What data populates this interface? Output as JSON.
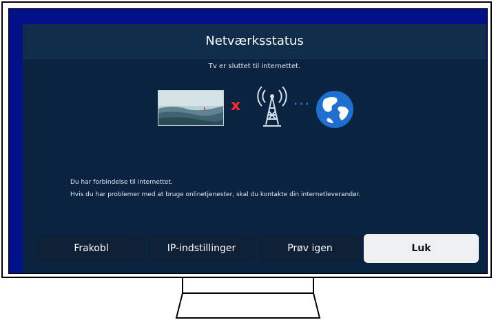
{
  "dialog": {
    "title": "Netværksstatus",
    "status_line": "Tv er sluttet til internettet.",
    "message_lines": [
      "Du har forbindelse til internettet.",
      "Hvis du har problemer med at bruge onlinetjenester, skal du kontakte din internetleverandør."
    ],
    "diagram": {
      "icons": [
        "tv-thumbnail-icon",
        "x-mark-icon",
        "antenna-tower-icon",
        "dotted-connection-icon",
        "globe-icon"
      ],
      "x_mark": "x",
      "dots": "···"
    },
    "buttons": [
      {
        "label": "Frakobl"
      },
      {
        "label": "IP-indstillinger"
      },
      {
        "label": "Prøv igen"
      },
      {
        "label": "Luk",
        "selected": true
      }
    ]
  },
  "colors": {
    "screen_background": "#00118a",
    "dialog_background": "#0a2341",
    "button_background": "#0f2136",
    "selected_button": "#eef0f2",
    "error_red": "#ff2a2a",
    "link_blue": "#3a8be6"
  }
}
